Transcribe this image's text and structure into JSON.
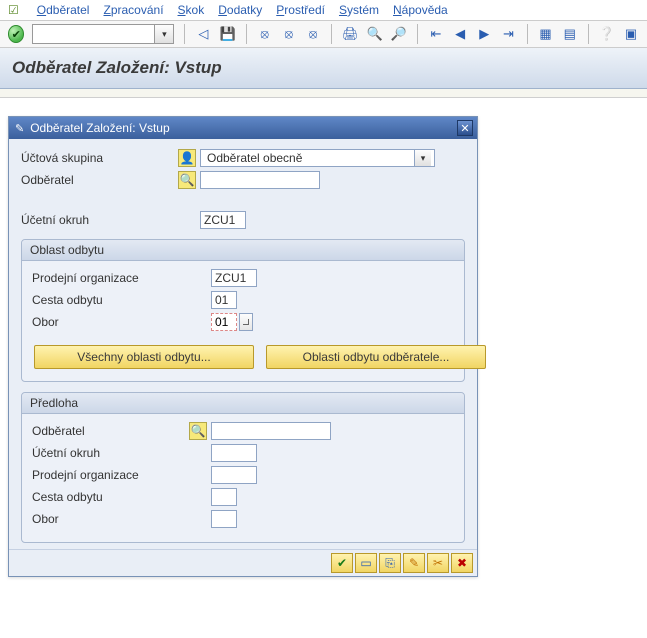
{
  "menu": {
    "items": [
      {
        "pre": "O",
        "rest": "dběratel"
      },
      {
        "pre": "Z",
        "rest": "pracování"
      },
      {
        "pre": "S",
        "rest": "kok"
      },
      {
        "pre": "D",
        "rest": "odatky"
      },
      {
        "pre": "P",
        "rest": "rostředí"
      },
      {
        "pre": "S",
        "rest": "ystém"
      },
      {
        "pre": "N",
        "rest": "ápověda"
      }
    ]
  },
  "toolbar": {
    "ok_glyph": "✔",
    "command_value": "",
    "command_placeholder": "",
    "drop_glyph": "▾",
    "back_glyph": "◁",
    "save_glyph": "💾",
    "globe_back": "⦻",
    "globe_fwd": "⦻",
    "globe_cancel": "⦻",
    "print": "🖨",
    "find": "🔍",
    "find_next": "🔎",
    "first": "⇤",
    "prev": "◀",
    "next": "▶",
    "last": "⇥",
    "layout1": "▦",
    "layout2": "▤",
    "help": "❔",
    "settings": "▣"
  },
  "page_title": "Odběratel Založení: Vstup",
  "dialog": {
    "title": "Odběratel Založení: Vstup",
    "icon": "✎",
    "close_glyph": "✕",
    "main": {
      "account_group_label": "Účtová skupina",
      "account_group_value": "Odběratel obecně",
      "customer_label": "Odběratel",
      "customer_value": "",
      "company_code_label": "Účetní okruh",
      "company_code_value": "ZCU1",
      "pre_icon_person": "👤",
      "pre_icon_search": "🔍"
    },
    "sales": {
      "title": "Oblast odbytu",
      "sales_org_label": "Prodejní organizace",
      "sales_org_value": "ZCU1",
      "dist_channel_label": "Cesta odbytu",
      "dist_channel_value": "01",
      "division_label": "Obor",
      "division_value": "01",
      "btn_all_areas": "Všechny oblasti odbytu...",
      "btn_cust_areas": "Oblasti odbytu odběratele..."
    },
    "template": {
      "title": "Předloha",
      "customer_label": "Odběratel",
      "customer_value": "",
      "company_code_label": "Účetní okruh",
      "company_code_value": "",
      "sales_org_label": "Prodejní organizace",
      "sales_org_value": "",
      "dist_channel_label": "Cesta odbytu",
      "dist_channel_value": "",
      "division_label": "Obor",
      "division_value": ""
    },
    "footer": {
      "ok": "✔",
      "addr": "▭",
      "copy": "⎘",
      "edit": "✎",
      "delete": "✂",
      "cancel": "✖"
    }
  }
}
